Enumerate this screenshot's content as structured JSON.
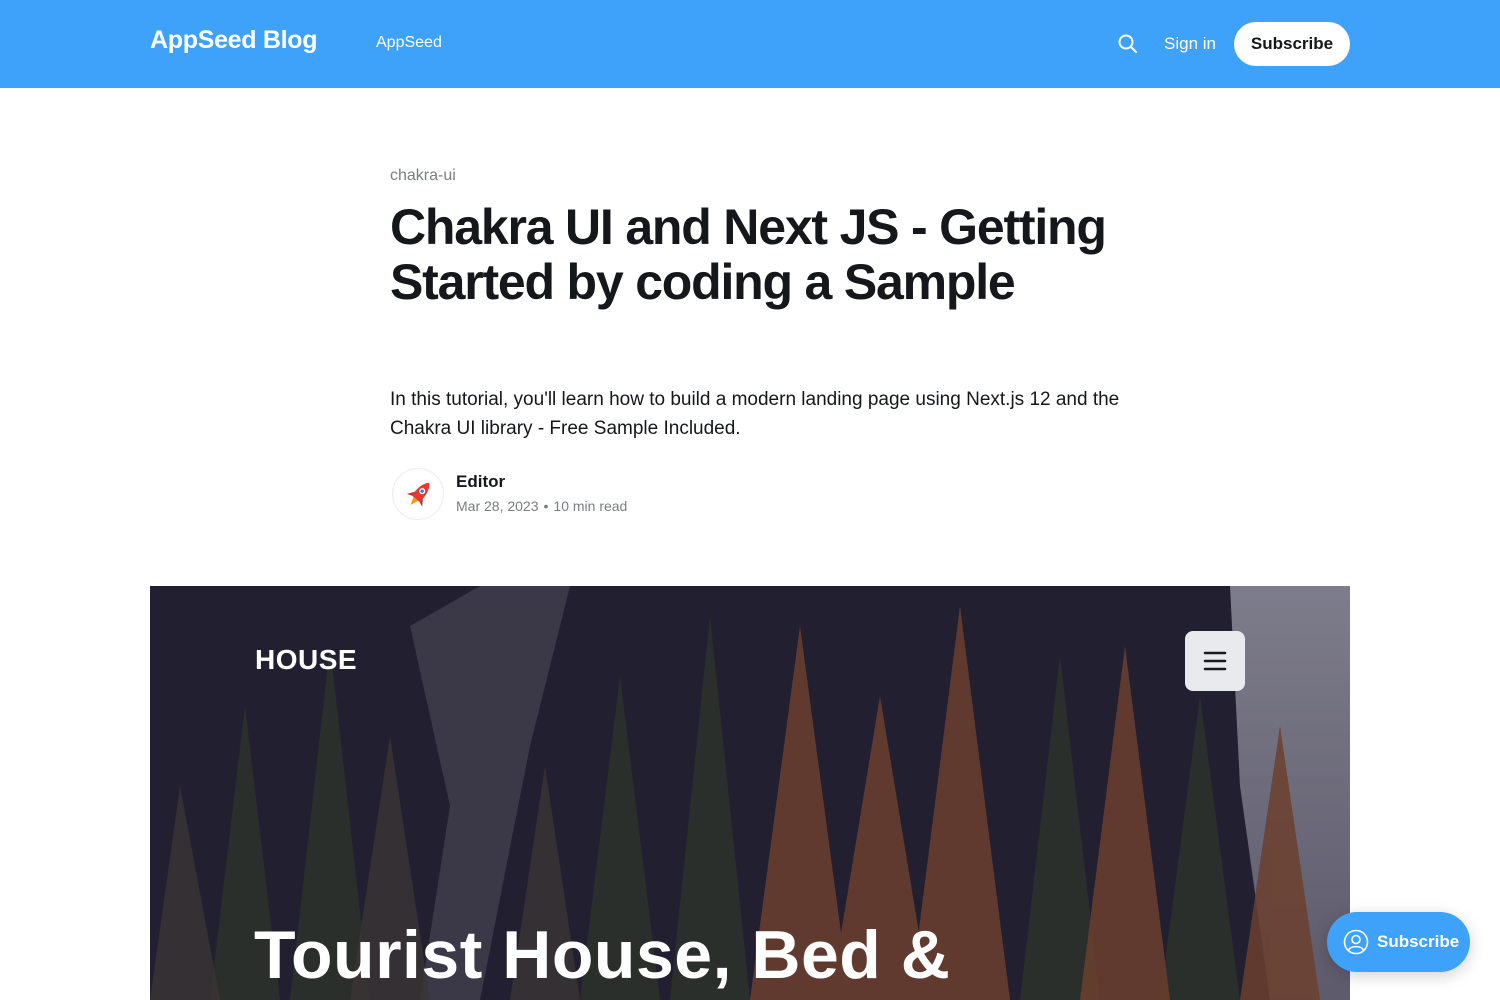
{
  "header": {
    "brand": "AppSeed Blog",
    "nav_link": "AppSeed",
    "search_icon": "search-icon",
    "signin_label": "Sign in",
    "subscribe_label": "Subscribe",
    "accent_color": "#3ea2fb"
  },
  "article": {
    "tag": "chakra-ui",
    "title": "Chakra UI and Next JS - Getting Started by coding a Sample",
    "excerpt": "In this tutorial, you'll learn how to build a modern landing page using Next.js 12 and the Chakra UI library - Free Sample Included.",
    "author": {
      "name": "Editor",
      "avatar_icon": "rocket-icon"
    },
    "date": "Mar 28, 2023",
    "separator": "•",
    "read_time": "10 min read"
  },
  "feature_image": {
    "logo": "HOUSE",
    "menu_icon": "hamburger-menu-icon",
    "headline": "Tourist House, Bed &"
  },
  "portal": {
    "label": "Subscribe",
    "icon": "user-circle-icon"
  }
}
